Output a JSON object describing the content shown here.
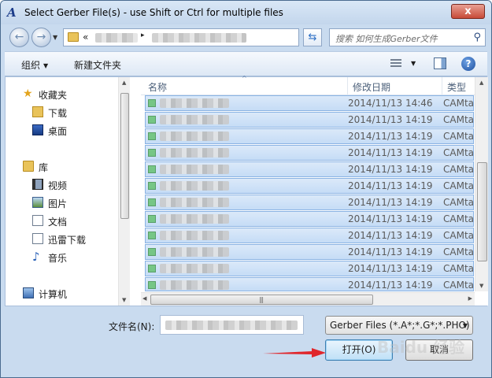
{
  "window": {
    "title": "Select Gerber File(s) - use Shift or Ctrl for multiple files",
    "close_symbol": "x"
  },
  "address": {
    "chevron": "«",
    "separator": "▸",
    "search_placeholder": "搜索 如何生成Gerber文件"
  },
  "toolbar": {
    "organize_label": "组织",
    "new_folder_label": "新建文件夹"
  },
  "nav": {
    "items": [
      {
        "label": "收藏夹",
        "icon": "star-icon"
      },
      {
        "label": "下载",
        "icon": "download-folder-icon"
      },
      {
        "label": "桌面",
        "icon": "desktop-icon"
      },
      {
        "label": "库",
        "icon": "library-icon"
      },
      {
        "label": "视频",
        "icon": "video-icon"
      },
      {
        "label": "图片",
        "icon": "picture-icon"
      },
      {
        "label": "文档",
        "icon": "document-icon"
      },
      {
        "label": "迅雷下载",
        "icon": "thunder-download-icon"
      },
      {
        "label": "音乐",
        "icon": "music-icon"
      },
      {
        "label": "计算机",
        "icon": "computer-icon"
      }
    ]
  },
  "columns": {
    "name": "名称",
    "date": "修改日期",
    "type": "类型"
  },
  "files": [
    {
      "date": "2014/11/13 14:46",
      "type": "CAMtastic"
    },
    {
      "date": "2014/11/13 14:19",
      "type": "CAMtastic"
    },
    {
      "date": "2014/11/13 14:19",
      "type": "CAMtastic"
    },
    {
      "date": "2014/11/13 14:19",
      "type": "CAMtastic"
    },
    {
      "date": "2014/11/13 14:19",
      "type": "CAMtastic"
    },
    {
      "date": "2014/11/13 14:19",
      "type": "CAMtastic"
    },
    {
      "date": "2014/11/13 14:19",
      "type": "CAMtastic"
    },
    {
      "date": "2014/11/13 14:19",
      "type": "CAMtastic"
    },
    {
      "date": "2014/11/13 14:19",
      "type": "CAMtastic"
    },
    {
      "date": "2014/11/13 14:19",
      "type": "CAMtastic"
    },
    {
      "date": "2014/11/13 14:19",
      "type": "CAMtastic"
    },
    {
      "date": "2014/11/13 14:19",
      "type": "CAMtastic"
    }
  ],
  "footer": {
    "filename_label": "文件名(N):",
    "filter_value": "Gerber Files (*.A*;*.G*;*.PHO)",
    "open_label": "打开(O)",
    "cancel_label": "取消"
  },
  "watermark": "Baidu 经验",
  "colors": {
    "selection": "#c5dcf6",
    "selection_border": "#8ab3e3",
    "frame": "#c9dbef",
    "arrow": "#e0262b"
  }
}
